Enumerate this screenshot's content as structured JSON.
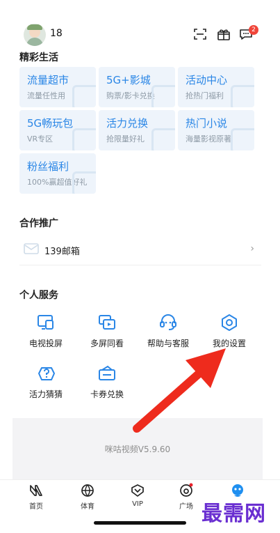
{
  "header": {
    "username": "18",
    "message_badge": "2"
  },
  "sections": {
    "featured": "精彩生活",
    "partners": "合作推广",
    "personal": "个人服务"
  },
  "tiles": [
    {
      "title": "流量超市",
      "subtitle": "流量任性用"
    },
    {
      "title": "5G+影城",
      "subtitle": "购票/影卡兑换"
    },
    {
      "title": "活动中心",
      "subtitle": "抢热门福利"
    },
    {
      "title": "5G畅玩包",
      "subtitle": "VR专区"
    },
    {
      "title": "活力兑换",
      "subtitle": "抢限量好礼"
    },
    {
      "title": "热门小说",
      "subtitle": "海量影视原著"
    },
    {
      "title": "粉丝福利",
      "subtitle": "100%赢超值好礼"
    }
  ],
  "partner": {
    "label": "139邮箱",
    "arrow": "›"
  },
  "services": [
    {
      "label": "电视投屏",
      "icon": "tv-cast-icon"
    },
    {
      "label": "多屏同看",
      "icon": "multi-screen-icon"
    },
    {
      "label": "帮助与客服",
      "icon": "customer-service-icon"
    },
    {
      "label": "我的设置",
      "icon": "settings-icon"
    },
    {
      "label": "活力猜猜",
      "icon": "guess-icon"
    },
    {
      "label": "卡券兑换",
      "icon": "coupon-icon"
    }
  ],
  "footer": {
    "version": "咪咕视频V5.9.60"
  },
  "tabs": [
    {
      "label": "首页",
      "icon": "home-icon"
    },
    {
      "label": "体育",
      "icon": "sports-icon"
    },
    {
      "label": "VIP",
      "icon": "vip-icon"
    },
    {
      "label": "广场",
      "icon": "square-icon"
    },
    {
      "label": "",
      "icon": "profile-icon",
      "active": true
    }
  ],
  "colors": {
    "accent": "#2a86e6",
    "tile_bg": "#eef4fb",
    "badge": "#f0453a",
    "arrow": "#ee2b1d"
  },
  "watermark": "最需网"
}
